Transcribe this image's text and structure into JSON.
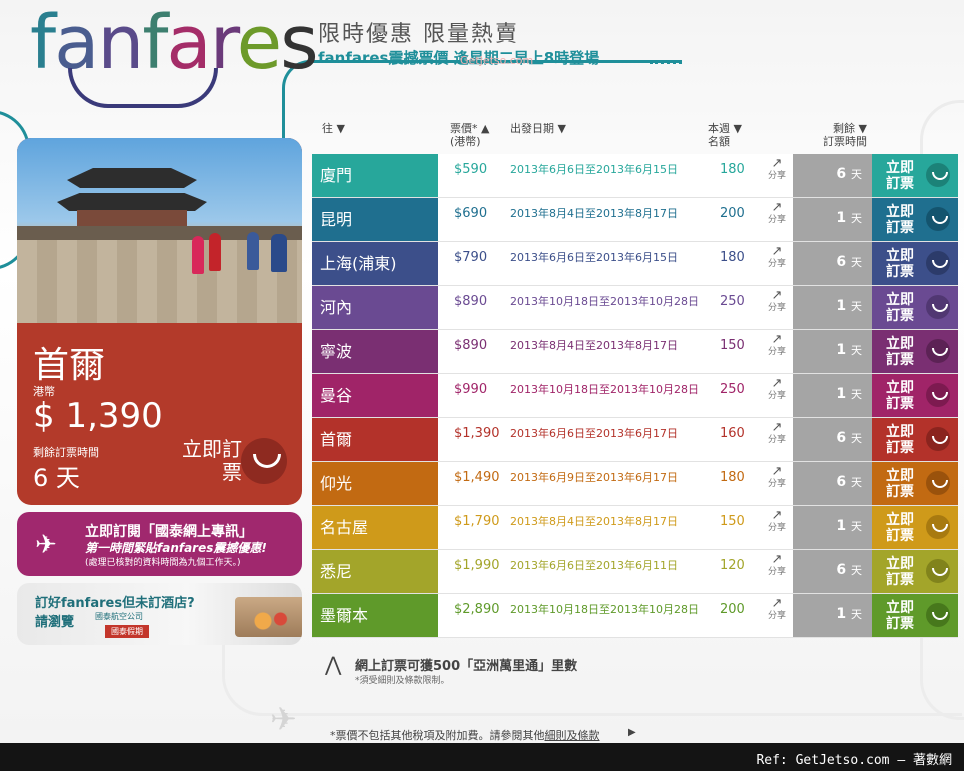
{
  "logo": {
    "letters": [
      "f",
      "a",
      "n",
      "f",
      "a",
      "r",
      "e",
      "s"
    ]
  },
  "header": {
    "title": "限時優惠 限量熱賣",
    "subtitle": "fanfares震撼票價 逢星期二早上8時登場",
    "watermark": "GetJetso.com"
  },
  "feature": {
    "city": "首爾",
    "currency": "港幣",
    "price": "$ 1,390",
    "remaining_label": "剩餘訂票時間",
    "remaining": "6 天",
    "book_label": "立即訂票"
  },
  "promo1": {
    "line1": "立即訂閱「國泰網上專訊」",
    "line2": "第一時間緊貼fanfares震撼優惠!",
    "line3": "(處理已核對的資料時間為九個工作天。)"
  },
  "promo2": {
    "line1": "訂好fanfares但未訂酒店?",
    "line2": "請瀏覽",
    "brand": "國泰航空公司",
    "badge": "國泰假期"
  },
  "table_header": {
    "dest": "往 ▼",
    "price_line1": "票價* ▲",
    "price_line2": "(港幣)",
    "date": "出發日期 ▼",
    "quota_line1": "本週 ▼",
    "quota_line2": "名額",
    "rem_line1": "剩餘 ▼",
    "rem_line2": "訂票時間"
  },
  "rows": [
    {
      "dest": "廈門",
      "price": "$590",
      "date": "2013年6月6日至2013年6月15日",
      "quota": "180",
      "share": "分享",
      "rem": "6",
      "unit": "天",
      "book": "立即訂票",
      "color": "#27a79b",
      "dark": "#1c8278",
      "text": "#27a79b"
    },
    {
      "dest": "昆明",
      "price": "$690",
      "date": "2013年8月4日至2013年8月17日",
      "quota": "200",
      "share": "分享",
      "rem": "1",
      "unit": "天",
      "book": "立即訂票",
      "color": "#1f6f8f",
      "dark": "#14546e",
      "text": "#1f6f8f"
    },
    {
      "dest": "上海(浦東)",
      "price": "$790",
      "date": "2013年6月6日至2013年6月15日",
      "quota": "180",
      "share": "分享",
      "rem": "6",
      "unit": "天",
      "book": "立即訂票",
      "color": "#3c4f8a",
      "dark": "#2c3b6a",
      "text": "#3c4f8a"
    },
    {
      "dest": "河內",
      "price": "$890",
      "date": "2013年10月18日至2013年10月28日",
      "quota": "250",
      "share": "分享",
      "rem": "1",
      "unit": "天",
      "book": "立即訂票",
      "color": "#6a4a92",
      "dark": "#513772",
      "text": "#6a4a92"
    },
    {
      "dest": "寧波",
      "price": "$890",
      "date": "2013年8月4日至2013年8月17日",
      "quota": "150",
      "share": "分享",
      "rem": "1",
      "unit": "天",
      "book": "立即訂票",
      "color": "#7a2f72",
      "dark": "#5c2255",
      "text": "#7a2f72"
    },
    {
      "dest": "曼谷",
      "price": "$990",
      "date": "2013年10月18日至2013年10月28日",
      "quota": "250",
      "share": "分享",
      "rem": "1",
      "unit": "天",
      "book": "立即訂票",
      "color": "#a02468",
      "dark": "#7d1a50",
      "text": "#a02468"
    },
    {
      "dest": "首爾",
      "price": "$1,390",
      "date": "2013年6月6日至2013年6月17日",
      "quota": "160",
      "share": "分享",
      "rem": "6",
      "unit": "天",
      "book": "立即訂票",
      "color": "#b3322a",
      "dark": "#8a241e",
      "text": "#b3322a"
    },
    {
      "dest": "仰光",
      "price": "$1,490",
      "date": "2013年6月9日至2013年6月17日",
      "quota": "180",
      "share": "分享",
      "rem": "6",
      "unit": "天",
      "book": "立即訂票",
      "color": "#c26a12",
      "dark": "#9a520c",
      "text": "#c26a12"
    },
    {
      "dest": "名古屋",
      "price": "$1,790",
      "date": "2013年8月4日至2013年8月17日",
      "quota": "150",
      "share": "分享",
      "rem": "1",
      "unit": "天",
      "book": "立即訂票",
      "color": "#cf9a1a",
      "dark": "#a87a10",
      "text": "#cf9a1a"
    },
    {
      "dest": "悉尼",
      "price": "$1,990",
      "date": "2013年6月6日至2013年6月11日",
      "quota": "120",
      "share": "分享",
      "rem": "6",
      "unit": "天",
      "book": "立即訂票",
      "color": "#a3a52a",
      "dark": "#81831c",
      "text": "#a3a52a"
    },
    {
      "dest": "墨爾本",
      "price": "$2,890",
      "date": "2013年10月18日至2013年10月28日",
      "quota": "200",
      "share": "分享",
      "rem": "1",
      "unit": "天",
      "book": "立即訂票",
      "color": "#5f9a2a",
      "dark": "#47781c",
      "text": "#5f9a2a"
    }
  ],
  "footer": {
    "miles_line1": "網上訂票可獲500「亞洲萬里通」里數",
    "miles_line2": "*須受細則及條款限制。",
    "disclaimer": "*票價不包括其他稅項及附加費。請參閱其他",
    "disclaimer_link": "細則及條款",
    "ref": "Ref: GetJetso.com — 著數網"
  }
}
